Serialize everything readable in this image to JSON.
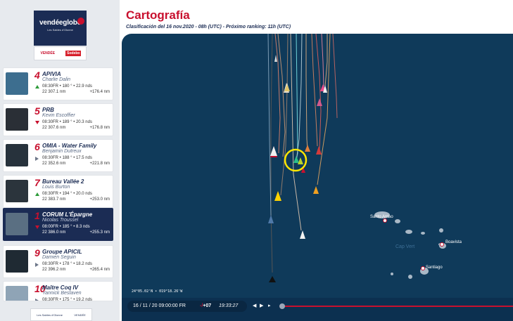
{
  "header": {
    "title": "Cartografía",
    "subtitle": "Clasificación del 16 nov.2020 - 08h (UTC) - Próximo ranking: 11h (UTC)"
  },
  "logo": {
    "brand": "vendéeglobe",
    "tagline": "Les Sables d'Olonne",
    "partners": [
      "VENDÉE",
      "Sodebo"
    ]
  },
  "footer_logo": [
    "Les Sables d'Olonne",
    "VENDÉE"
  ],
  "ranking": [
    {
      "rank": "4",
      "boat": "APIVIA",
      "skipper": "Charlie Dalin",
      "trend": "up",
      "stats": "08:30FR • 180 ° • 22.9 nds",
      "distance": "22 307.1 nm",
      "gap": "+176.4 nm",
      "active": false,
      "avatar_color": "#3d6e8f"
    },
    {
      "rank": "5",
      "boat": "PRB",
      "skipper": "Kevin Escoffier",
      "trend": "down",
      "stats": "08:30FR • 189 ° • 20.3 nds",
      "distance": "22 307.6 nm",
      "gap": "+176.8 nm",
      "active": false,
      "avatar_color": "#2a2f36"
    },
    {
      "rank": "6",
      "boat": "OMIA - Water Family",
      "skipper": "Benjamin Dutreux",
      "trend": "right",
      "stats": "08:30FR • 188 ° • 17.5 nds",
      "distance": "22 352.6 nm",
      "gap": "+221.8 nm",
      "active": false,
      "avatar_color": "#27323c"
    },
    {
      "rank": "7",
      "boat": "Bureau Vallée 2",
      "skipper": "Louis Burton",
      "trend": "up",
      "stats": "08:30FR • 194 ° • 20.0 nds",
      "distance": "22 383.7 nm",
      "gap": "+253.0 nm",
      "active": false,
      "avatar_color": "#2b343c"
    },
    {
      "rank": "1",
      "boat": "CORUM L'Épargne",
      "skipper": "Nicolas Troussel",
      "trend": "down",
      "stats": "08:00FR • 185 ° • 8.3 nds",
      "distance": "22 386.0 nm",
      "gap": "+255.3 nm",
      "active": true,
      "avatar_color": "#5a6f82"
    },
    {
      "rank": "9",
      "boat": "Groupe APICIL",
      "skipper": "Damien Seguin",
      "trend": "right",
      "stats": "08:30FR • 178 ° • 18.2 nds",
      "distance": "22 396.2 nm",
      "gap": "+265.4 nm",
      "active": false,
      "avatar_color": "#1f2a33"
    },
    {
      "rank": "10",
      "boat": "Maître Coq IV",
      "skipper": "Yannick Bestaven",
      "trend": "right",
      "stats": "08:30FR • 175 ° • 19.2 nds",
      "distance": "",
      "gap": "",
      "active": false,
      "avatar_color": "#8fa4b6"
    }
  ],
  "map": {
    "coords": "24°05.02'N • 019°18.26'W",
    "places": [
      "Santo Antao",
      "Boavista",
      "Santiago"
    ],
    "region": "Cap Vert"
  },
  "timeline": {
    "date": "16 / 11 / 20 09:00:00 FR",
    "speed_sign": "-/",
    "speed": "+07",
    "clock": "19:33:27",
    "controls": [
      "◀",
      "▶",
      "▸"
    ],
    "progress": 0.0
  },
  "colors": {
    "accent": "#c8102e",
    "navy": "#1b2c54",
    "sea": "#0f3a5a",
    "highlight": "#ffe600"
  }
}
